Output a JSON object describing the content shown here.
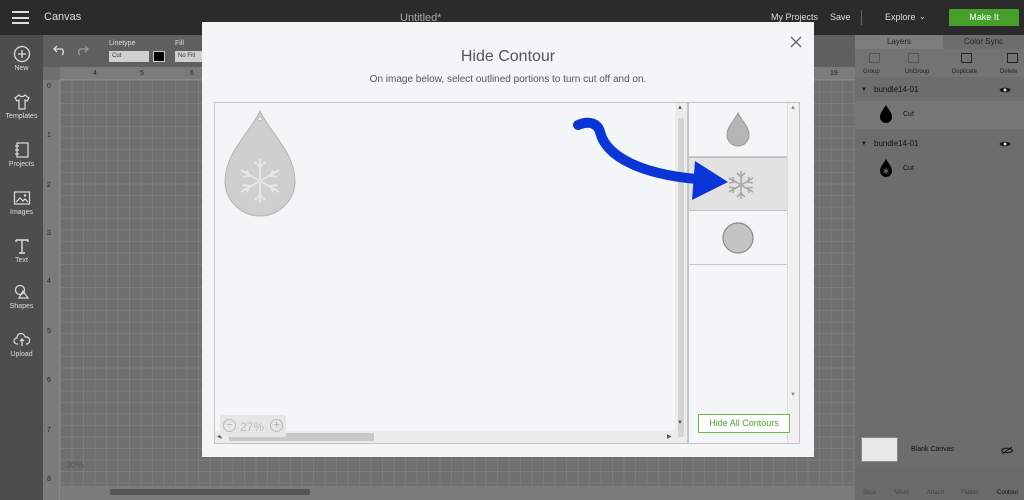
{
  "topbar": {
    "app_title": "Canvas",
    "doc_title": "Untitled*",
    "my_projects": "My Projects",
    "save": "Save",
    "explore": "Explore",
    "make_it": "Make It"
  },
  "sidebar": {
    "items": [
      {
        "label": "New",
        "icon": "plus-circle-icon"
      },
      {
        "label": "Templates",
        "icon": "shirt-icon"
      },
      {
        "label": "Projects",
        "icon": "projects-icon"
      },
      {
        "label": "Images",
        "icon": "image-icon"
      },
      {
        "label": "Text",
        "icon": "text-icon"
      },
      {
        "label": "Shapes",
        "icon": "shapes-icon"
      },
      {
        "label": "Upload",
        "icon": "upload-cloud-icon"
      }
    ]
  },
  "toolbar": {
    "linetype_label": "Linetype",
    "linetype_value": "Cut",
    "fill_label": "Fill",
    "fill_value": "No Fill"
  },
  "rulers": {
    "top": [
      "4",
      "5",
      "6",
      "19"
    ],
    "left": [
      "0",
      "1",
      "2",
      "3",
      "4",
      "5",
      "6",
      "7",
      "8"
    ]
  },
  "canvas": {
    "zoom_label": "30%"
  },
  "right_panel": {
    "tabs": [
      "Layers",
      "Color Sync"
    ],
    "tools": [
      "Group",
      "UnGroup",
      "Duplicate",
      "Delete"
    ],
    "layers": [
      {
        "name": "bundle14-01",
        "operation": "Cut"
      },
      {
        "name": "bundle14-01",
        "operation": "Cut"
      }
    ],
    "blank_canvas": "Blank Canvas",
    "bottom_tools": [
      "Slice",
      "Weld",
      "Attach",
      "Flatten",
      "Contour"
    ]
  },
  "modal": {
    "title": "Hide Contour",
    "subtitle": "On image below, select outlined portions to turn cut off and on.",
    "zoom": "27%",
    "hide_all_button": "Hide All Contours",
    "contour_items": [
      "teardrop-shape",
      "snowflake-shape",
      "circle-shape"
    ],
    "colors": {
      "accent_green": "#4f9d2c",
      "annotation_blue": "#0a36d8"
    }
  }
}
